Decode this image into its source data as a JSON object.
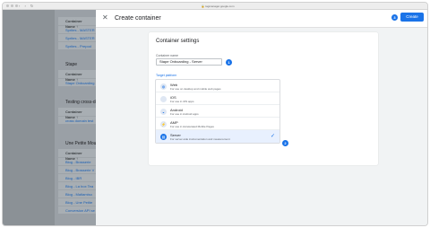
{
  "browser": {
    "url": "tagmanager.google.com",
    "nav": "‹ › ↻"
  },
  "background": {
    "sections": [
      {
        "header": "Container Name ↑",
        "rows": [
          "Sprites - MASTER",
          "Sprites - MASTER",
          "Sprites - Prepod"
        ]
      },
      {
        "title": "Stape",
        "header": "Container Name ↑",
        "rows": [
          "Stape Onboarding"
        ]
      },
      {
        "title": "Testing cross-do",
        "header": "Container Name ↑",
        "rows": [
          "cross domain test"
        ]
      },
      {
        "title": "Une Petite Mous",
        "header": "Container Name ↑",
        "rows": [
          "Blog - Brasserie",
          "Blog - Brasserie V",
          "Blog - IBR",
          "Blog - La box Tea",
          "Blog - Maltamiso",
          "Blog - Une Petite",
          "Conversion API se"
        ]
      }
    ]
  },
  "dialog": {
    "title": "Create container",
    "create_label": "Create",
    "badges": [
      "3",
      "1",
      "2"
    ],
    "card": {
      "title": "Container settings",
      "name_label": "Container name",
      "name_value": "Stape Onboarding - Server",
      "platform_label": "Target platform",
      "platforms": [
        {
          "name": "Web",
          "desc": "For use on desktop and mobile web pages",
          "icon": "globe-icon",
          "glyph": "◍"
        },
        {
          "name": "iOS",
          "desc": "For use in iOS apps",
          "icon": "apple-icon",
          "glyph": ""
        },
        {
          "name": "Android",
          "desc": "For use in Android apps",
          "icon": "android-icon",
          "glyph": "◒"
        },
        {
          "name": "AMP",
          "desc": "For use in Accelerated Mobile Pages",
          "icon": "amp-icon",
          "glyph": "⚡"
        },
        {
          "name": "Server",
          "desc": "For server-side instrumentation and measurement",
          "icon": "server-icon",
          "glyph": "▤",
          "selected": true,
          "check": "✓"
        }
      ]
    }
  }
}
